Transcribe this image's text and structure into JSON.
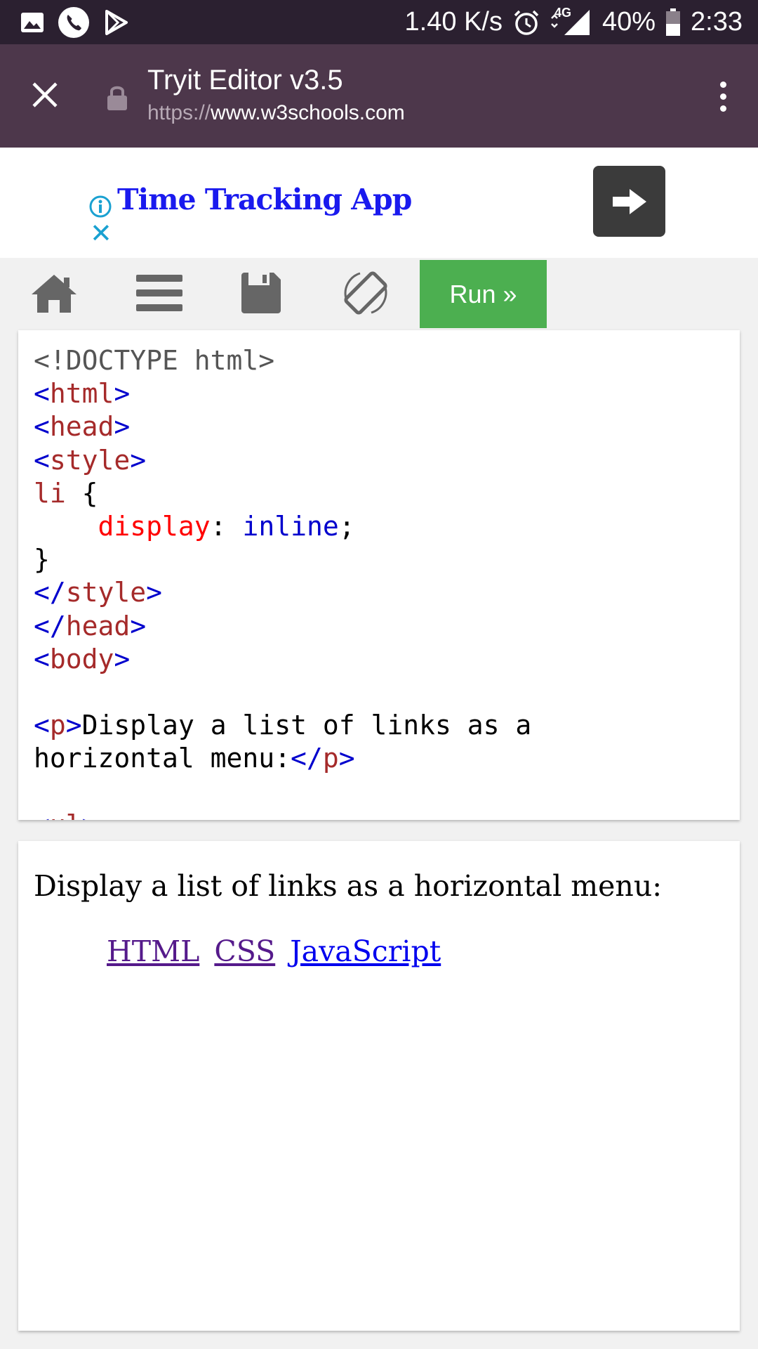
{
  "status_bar": {
    "speed": "1.40 K/s",
    "network": "4G",
    "battery": "40%",
    "time": "2:33",
    "icons": [
      "gallery-icon",
      "phone-icon",
      "play-store-icon",
      "alarm-icon",
      "signal-icon",
      "battery-icon"
    ]
  },
  "browser": {
    "tab_title": "Tryit Editor v3.5",
    "url_scheme": "https://",
    "url_host": "www.w3schools.com"
  },
  "ad": {
    "title": "Time Tracking App",
    "close_label": "✕"
  },
  "editor_toolbar": {
    "run_label": "Run »"
  },
  "code_lines": [
    "<!DOCTYPE html>",
    "<html>",
    "<head>",
    "<style>",
    "li {",
    "    display: inline;",
    "}",
    "</style>",
    "</head>",
    "<body>",
    "",
    "<p>Display a list of links as a",
    "horizontal menu:</p>",
    "",
    "<ul>"
  ],
  "result": {
    "text": "Display a list of links as a horizontal menu:",
    "links": [
      "HTML",
      "CSS",
      "JavaScript"
    ]
  },
  "colors": {
    "status_bar": "#2b2030",
    "browser_bar": "#4d374b",
    "run_button": "#4caf50",
    "tag": "#a52a2a",
    "bracket": "#0000cd",
    "property": "#ff0000"
  }
}
